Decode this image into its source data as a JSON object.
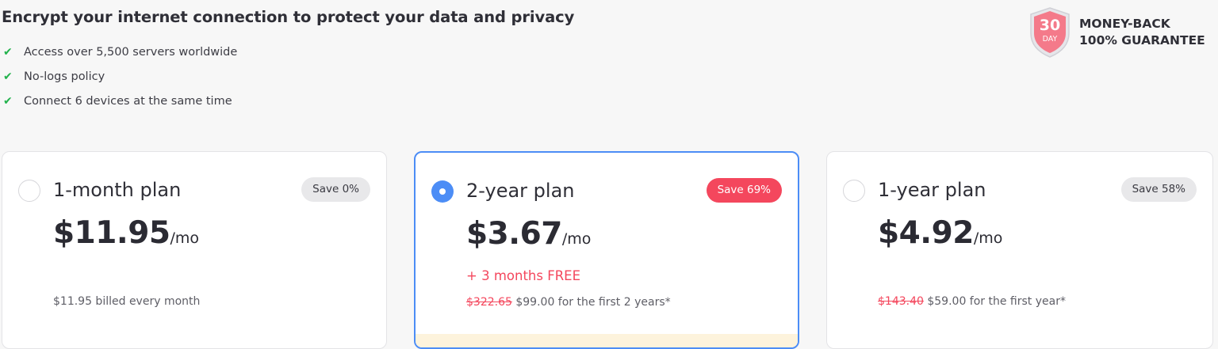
{
  "headline": "Encrypt your internet connection to protect your data and privacy",
  "features": [
    "Access over 5,500 servers worldwide",
    "No-logs policy",
    "Connect 6 devices at the same time"
  ],
  "guarantee": {
    "days_number": "30",
    "days_label": "DAY",
    "line1": "MONEY-BACK",
    "line2": "100% GUARANTEE"
  },
  "plans": [
    {
      "name": "1-month plan",
      "badge": "Save 0%",
      "price": "$11.95",
      "per": "/mo",
      "bonus": "",
      "old_price": "",
      "billing": "$11.95 billed every month",
      "selected": false
    },
    {
      "name": "2-year plan",
      "badge": "Save 69%",
      "price": "$3.67",
      "per": "/mo",
      "bonus": "+ 3 months FREE",
      "old_price": "$322.65",
      "billing": "$99.00 for the first 2 years*",
      "selected": true
    },
    {
      "name": "1-year plan",
      "badge": "Save 58%",
      "price": "$4.92",
      "per": "/mo",
      "bonus": "",
      "old_price": "$143.40",
      "billing": "$59.00 for the first year*",
      "selected": false
    }
  ],
  "colors": {
    "accent_blue": "#4c8df6",
    "sale_red": "#f4475d",
    "check_green": "#22b24c",
    "shield_pink": "#f47a8a"
  }
}
